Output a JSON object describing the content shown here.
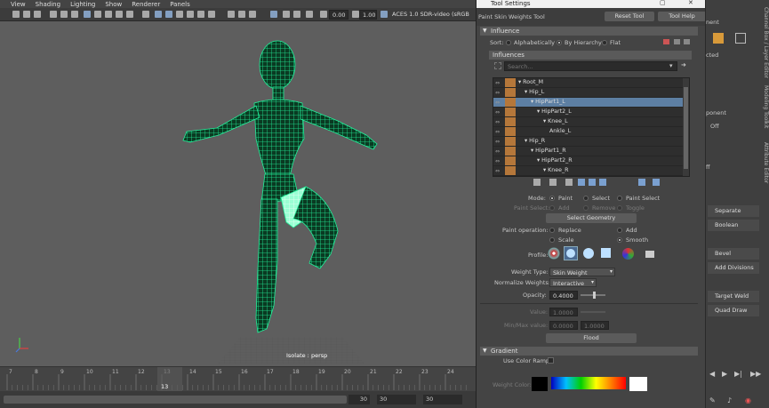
{
  "menu": [
    "View",
    "Shading",
    "Lighting",
    "Show",
    "Renderer",
    "Panels"
  ],
  "viewport_toolbar": {
    "exposure": "0.00",
    "gamma": "1.00",
    "color_space": "ACES 1.0 SDR-video (sRGB"
  },
  "viewport": {
    "camera_label": "Isolate : persp",
    "mesh_color": "#22ee99",
    "background": "#5e5e5e"
  },
  "timeline": {
    "ticks": [
      "7",
      "8",
      "9",
      "10",
      "11",
      "12",
      "13",
      "14",
      "15",
      "16",
      "17",
      "18",
      "19",
      "20",
      "21",
      "22",
      "23",
      "24"
    ],
    "current_frame": "13",
    "range_values": [
      "30",
      "30",
      "30"
    ]
  },
  "panel": {
    "window_title": "Tool Settings",
    "tool_name": "Paint Skin Weights Tool",
    "reset_label": "Reset Tool",
    "help_label": "Tool Help",
    "influence_section": "Influence",
    "sort_label": "Sort:",
    "sort_options": [
      "Alphabetically",
      "By Hierarchy",
      "Flat"
    ],
    "influences_label": "Influences",
    "search_placeholder": "Search...",
    "tree": [
      "Root_M",
      "Hip_L",
      "HipPart1_L",
      "HipPart2_L",
      "Knee_L",
      "Ankle_L",
      "Hip_R",
      "HipPart1_R",
      "HipPart2_R",
      "Knee_R"
    ],
    "selected_influence": "HipPart1_L",
    "mode_label": "Mode:",
    "mode_options": [
      "Paint",
      "Select",
      "Paint Select"
    ],
    "paint_select_label": "Paint Select:",
    "paint_select_options": [
      "Add",
      "Remove",
      "Toggle"
    ],
    "select_geometry": "Select Geometry",
    "paint_op_label": "Paint operation:",
    "paint_ops": [
      "Replace",
      "Add",
      "Scale",
      "Smooth"
    ],
    "profile_label": "Profile:",
    "weight_type_label": "Weight Type:",
    "weight_type_value": "Skin Weight",
    "normalize_label": "Normalize Weights:",
    "normalize_value": "Interactive",
    "opacity_label": "Opacity:",
    "opacity_value": "0.4000",
    "opacity_level": 0.4,
    "value_label": "Value:",
    "value_value": "1.0000",
    "minmax_label": "Min/Max value:",
    "min_value": "0.0000",
    "max_value": "1.0000",
    "flood_label": "Flood",
    "gradient_section": "Gradient",
    "use_color_ramp": "Use Color Ramp",
    "weight_color_label": "Weight Color:"
  },
  "right_shelf": {
    "partial_labels": [
      "nent",
      "cted",
      "ponent",
      "Off",
      "ff"
    ],
    "buttons": [
      "Separate",
      "Boolean",
      "Bevel",
      "Add Divisions",
      "Target Weld",
      "Quad Draw"
    ],
    "tabs": [
      "Attribute Editor",
      "Modeling Toolkit",
      "Channel Box / Layer Editor"
    ]
  }
}
